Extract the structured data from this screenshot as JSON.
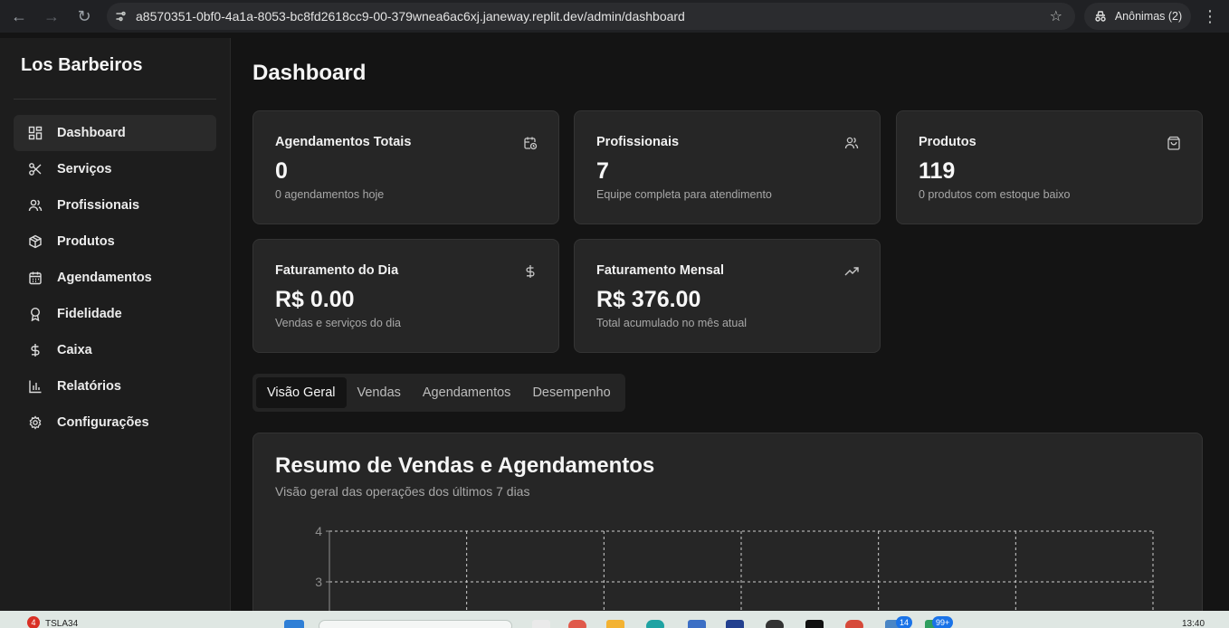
{
  "browser": {
    "url": "a8570351-0bf0-4a1a-8053-bc8fd2618cc9-00-379wnea6ac6xj.janeway.replit.dev/admin/dashboard",
    "profile_label": "Anônimas (2)"
  },
  "sidebar": {
    "brand": "Los Barbeiros",
    "items": [
      {
        "label": "Dashboard",
        "icon": "dashboard-icon"
      },
      {
        "label": "Serviços",
        "icon": "scissors-icon"
      },
      {
        "label": "Profissionais",
        "icon": "users-icon"
      },
      {
        "label": "Produtos",
        "icon": "package-icon"
      },
      {
        "label": "Agendamentos",
        "icon": "calendar-icon"
      },
      {
        "label": "Fidelidade",
        "icon": "award-icon"
      },
      {
        "label": "Caixa",
        "icon": "dollar-icon"
      },
      {
        "label": "Relatórios",
        "icon": "bar-chart-icon"
      },
      {
        "label": "Configurações",
        "icon": "gear-icon"
      }
    ]
  },
  "main": {
    "title": "Dashboard",
    "cards": [
      {
        "title": "Agendamentos Totais",
        "value": "0",
        "sub": "0 agendamentos hoje",
        "icon": "calendar-clock-icon"
      },
      {
        "title": "Profissionais",
        "value": "7",
        "sub": "Equipe completa para atendimento",
        "icon": "users-icon"
      },
      {
        "title": "Produtos",
        "value": "119",
        "sub": "0 produtos com estoque baixo",
        "icon": "shopping-bag-icon"
      },
      {
        "title": "Faturamento do Dia",
        "value": "R$ 0.00",
        "sub": "Vendas e serviços do dia",
        "icon": "dollar-icon"
      },
      {
        "title": "Faturamento Mensal",
        "value": "R$ 376.00",
        "sub": "Total acumulado no mês atual",
        "icon": "trending-up-icon"
      }
    ],
    "tabs": [
      "Visão Geral",
      "Vendas",
      "Agendamentos",
      "Desempenho"
    ],
    "chart_card": {
      "title": "Resumo de Vendas e Agendamentos",
      "subtitle": "Visão geral das operações dos últimos 7 dias"
    }
  },
  "chart_data": {
    "type": "line",
    "y_ticks": [
      "4",
      "3"
    ],
    "grid": true
  },
  "taskbar": {
    "notification_count": "4",
    "weather_label": "TSLA34",
    "badge_a": "14",
    "badge_b": "99+",
    "time": "13:40"
  }
}
